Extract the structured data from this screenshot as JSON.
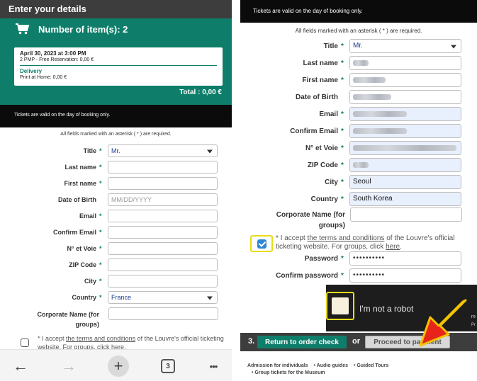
{
  "left": {
    "header_title": "Enter your details",
    "cart_label": "Number of item(s): 2",
    "card": {
      "date": "April 30, 2023 at 3:00 PM",
      "item_line": "2  PMP - Free Reservation:  0,00 €",
      "delivery_label": "Delivery",
      "delivery_line": "Print at Home:  0,00 €"
    },
    "total": "Total : 0,00 €",
    "tickets_notice": "Tickets are valid on the day of booking only.",
    "required_notice": "All fields marked with an asterisk ( * ) are required.",
    "fields": {
      "title_label": "Title",
      "title_value": "Mr.",
      "last_name_label": "Last name",
      "first_name_label": "First name",
      "dob_label": "Date of Birth",
      "dob_placeholder": "MM/DD/YYYY",
      "email_label": "Email",
      "confirm_email_label": "Confirm Email",
      "street_label": "N° et Voie",
      "zip_label": "ZIP Code",
      "city_label": "City",
      "country_label": "Country",
      "country_value": "France",
      "corporate_label": "Corporate Name (for groups)"
    },
    "accept": {
      "prefix": "* I accept ",
      "link": "the terms and conditions",
      "middle": " of the Louvre's official ticketing website. For groups, click ",
      "here": "here",
      "suffix": "."
    },
    "nav": {
      "back_icon": "←",
      "forward_icon": "→",
      "new_tab_icon": "+",
      "tab_count": "3",
      "menu_icon": "•••"
    }
  },
  "right": {
    "tickets_notice": "Tickets are valid on the day of booking only.",
    "required_notice": "All fields marked with an asterisk ( * ) are required.",
    "fields": {
      "title_label": "Title",
      "title_value": "Mr.",
      "last_name_label": "Last name",
      "first_name_label": "First name",
      "dob_label": "Date of Birth",
      "email_label": "Email",
      "confirm_email_label": "Confirm Email",
      "street_label": "N° et Voie",
      "zip_label": "ZIP Code",
      "city_label": "City",
      "city_value": "Seoul",
      "country_label": "Country",
      "country_value": "South Korea",
      "corporate_label": "Corporate Name (for groups)",
      "password_label": "Password",
      "password_value": "••••••••••",
      "confirm_password_label": "Confirm password",
      "confirm_password_value": "••••••••••"
    },
    "accept": {
      "prefix": "* I accept ",
      "link": "the terms and conditions",
      "middle": " of the Louvre's official ticketing website. For groups, click ",
      "here": "here",
      "suffix": "."
    },
    "captcha": {
      "label": "I'm not a robot",
      "re": "re",
      "pr": "Pr"
    },
    "step": {
      "number": "3.",
      "return_label": "Return to order check",
      "or_label": "or",
      "proceed_label": "Proceed to payment"
    },
    "footer": {
      "links": [
        "Admission for individuals",
        "• Audio guides",
        "• Guided Tours"
      ],
      "second_line": "• Group tickets for the Museum"
    }
  },
  "colors": {
    "brand_green": "#0e7e6a",
    "highlight_yellow": "#e8dc1a",
    "arrow_red": "#e8241a",
    "arrow_border": "#f2c400"
  }
}
